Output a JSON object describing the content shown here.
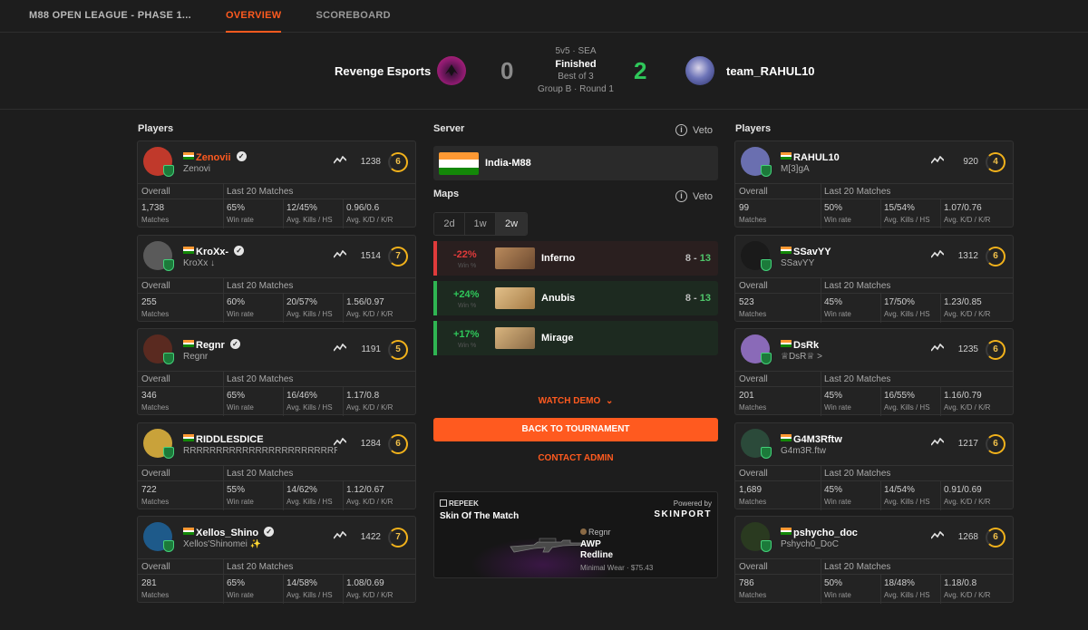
{
  "nav": {
    "title": "M88 OPEN LEAGUE - PHASE 1...",
    "tabs": [
      "OVERVIEW",
      "SCOREBOARD"
    ]
  },
  "match": {
    "team_left": "Revenge Esports",
    "team_right": "team_RAHUL10",
    "score_left": "0",
    "score_right": "2",
    "format": "5v5 · SEA",
    "status": "Finished",
    "best_of": "Best of 3",
    "round": "Group B · Round 1"
  },
  "labels": {
    "players": "Players",
    "server": "Server",
    "maps": "Maps",
    "veto": "Veto",
    "overall": "Overall",
    "last20": "Last 20 Matches",
    "matches": "Matches",
    "win_rate": "Win rate",
    "avg_kills_hs": "Avg. Kills / HS",
    "avg_kd_kr": "Avg. K/D / K/R",
    "win_pct": "Win %"
  },
  "players_left": [
    {
      "nick": "Zenovii",
      "sub": "Zenovi",
      "elo": "1238",
      "level": "6",
      "matches": "1,738",
      "win_rate": "65%",
      "kills_hs": "12/45%",
      "kd_kr": "0.96/0.6",
      "verified": true,
      "nick_color": "#ff5a1f"
    },
    {
      "nick": "KroXx-",
      "sub": "KroXx ↓",
      "elo": "1514",
      "level": "7",
      "matches": "255",
      "win_rate": "60%",
      "kills_hs": "20/57%",
      "kd_kr": "1.56/0.97",
      "verified": true,
      "nick_color": "#ffffff"
    },
    {
      "nick": "Regnr",
      "sub": "Regnr",
      "elo": "1191",
      "level": "5",
      "matches": "346",
      "win_rate": "65%",
      "kills_hs": "16/46%",
      "kd_kr": "1.17/0.8",
      "verified": true,
      "nick_color": "#ffffff"
    },
    {
      "nick": "RIDDLESDICE",
      "sub": "RRRRRRRRRRRRRRRRRRRRRRRRR...",
      "elo": "1284",
      "level": "6",
      "matches": "722",
      "win_rate": "55%",
      "kills_hs": "14/62%",
      "kd_kr": "1.12/0.67",
      "verified": false,
      "nick_color": "#ffffff"
    },
    {
      "nick": "Xellos_Shino",
      "sub": "Xellos'Shinomei ✨",
      "elo": "1422",
      "level": "7",
      "matches": "281",
      "win_rate": "65%",
      "kills_hs": "14/58%",
      "kd_kr": "1.08/0.69",
      "verified": true,
      "nick_color": "#ffffff"
    }
  ],
  "players_right": [
    {
      "nick": "RAHUL10",
      "sub": "M[3]gA",
      "elo": "920",
      "level": "4",
      "matches": "99",
      "win_rate": "50%",
      "kills_hs": "15/54%",
      "kd_kr": "1.07/0.76"
    },
    {
      "nick": "SSavYY",
      "sub": "SSavYY",
      "elo": "1312",
      "level": "6",
      "matches": "523",
      "win_rate": "45%",
      "kills_hs": "17/50%",
      "kd_kr": "1.23/0.85"
    },
    {
      "nick": "DsRk",
      "sub": "♕DsR♕ >",
      "elo": "1235",
      "level": "6",
      "matches": "201",
      "win_rate": "45%",
      "kills_hs": "16/55%",
      "kd_kr": "1.16/0.79"
    },
    {
      "nick": "G4M3Rftw",
      "sub": "G4m3R.ftw",
      "elo": "1217",
      "level": "6",
      "matches": "1,689",
      "win_rate": "45%",
      "kills_hs": "14/54%",
      "kd_kr": "0.91/0.69"
    },
    {
      "nick": "pshycho_doc",
      "sub": "Pshych0_DoC",
      "elo": "1268",
      "level": "6",
      "matches": "786",
      "win_rate": "50%",
      "kills_hs": "18/48%",
      "kd_kr": "1.18/0.8"
    }
  ],
  "server": {
    "name": "India-M88"
  },
  "ranges": [
    "2d",
    "1w",
    "2w"
  ],
  "maps": [
    {
      "pct": "-22%",
      "name": "Inferno",
      "score_l": "8",
      "score_r": "13",
      "color": "#e03b3b"
    },
    {
      "pct": "+24%",
      "name": "Anubis",
      "score_l": "8",
      "score_r": "13",
      "color": "#2fb552"
    },
    {
      "pct": "+17%",
      "name": "Mirage",
      "score_l": "",
      "score_r": "",
      "color": "#2fb552"
    }
  ],
  "actions": {
    "watch_demo": "WATCH DEMO",
    "back": "BACK TO TOURNAMENT",
    "contact": "CONTACT ADMIN"
  },
  "promo": {
    "brand": "REPEEK",
    "title": "Skin Of The Match",
    "powered": "Powered by",
    "sponsor": "SKINPORT",
    "player": "Regnr",
    "weapon": "AWP",
    "skin": "Redline",
    "wear_price": "Minimal Wear · $75.43"
  },
  "colors": {
    "accent": "#ff5a1f",
    "win": "#2fb552",
    "loss": "#e03b3b",
    "level": "#f2b21b"
  }
}
